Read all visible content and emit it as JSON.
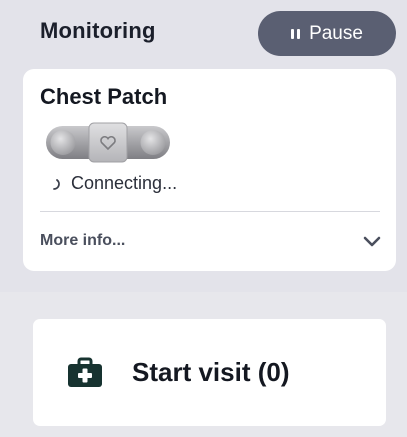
{
  "header": {
    "title": "Monitoring",
    "pause_label": "Pause"
  },
  "device": {
    "name": "Chest Patch",
    "status": "Connecting...",
    "more_info_label": "More info..."
  },
  "visit": {
    "label": "Start visit (0)"
  },
  "colors": {
    "background": "#e3e3ea",
    "pause_button": "#5a5f72",
    "card": "#ffffff",
    "kit_icon": "#173330"
  },
  "icons": {
    "pause": "pause-icon",
    "patch": "chest-patch-device-icon",
    "heart": "heart-icon",
    "spinner": "spinner-icon",
    "chevron": "chevron-down-icon",
    "kit": "first-aid-kit-icon"
  }
}
